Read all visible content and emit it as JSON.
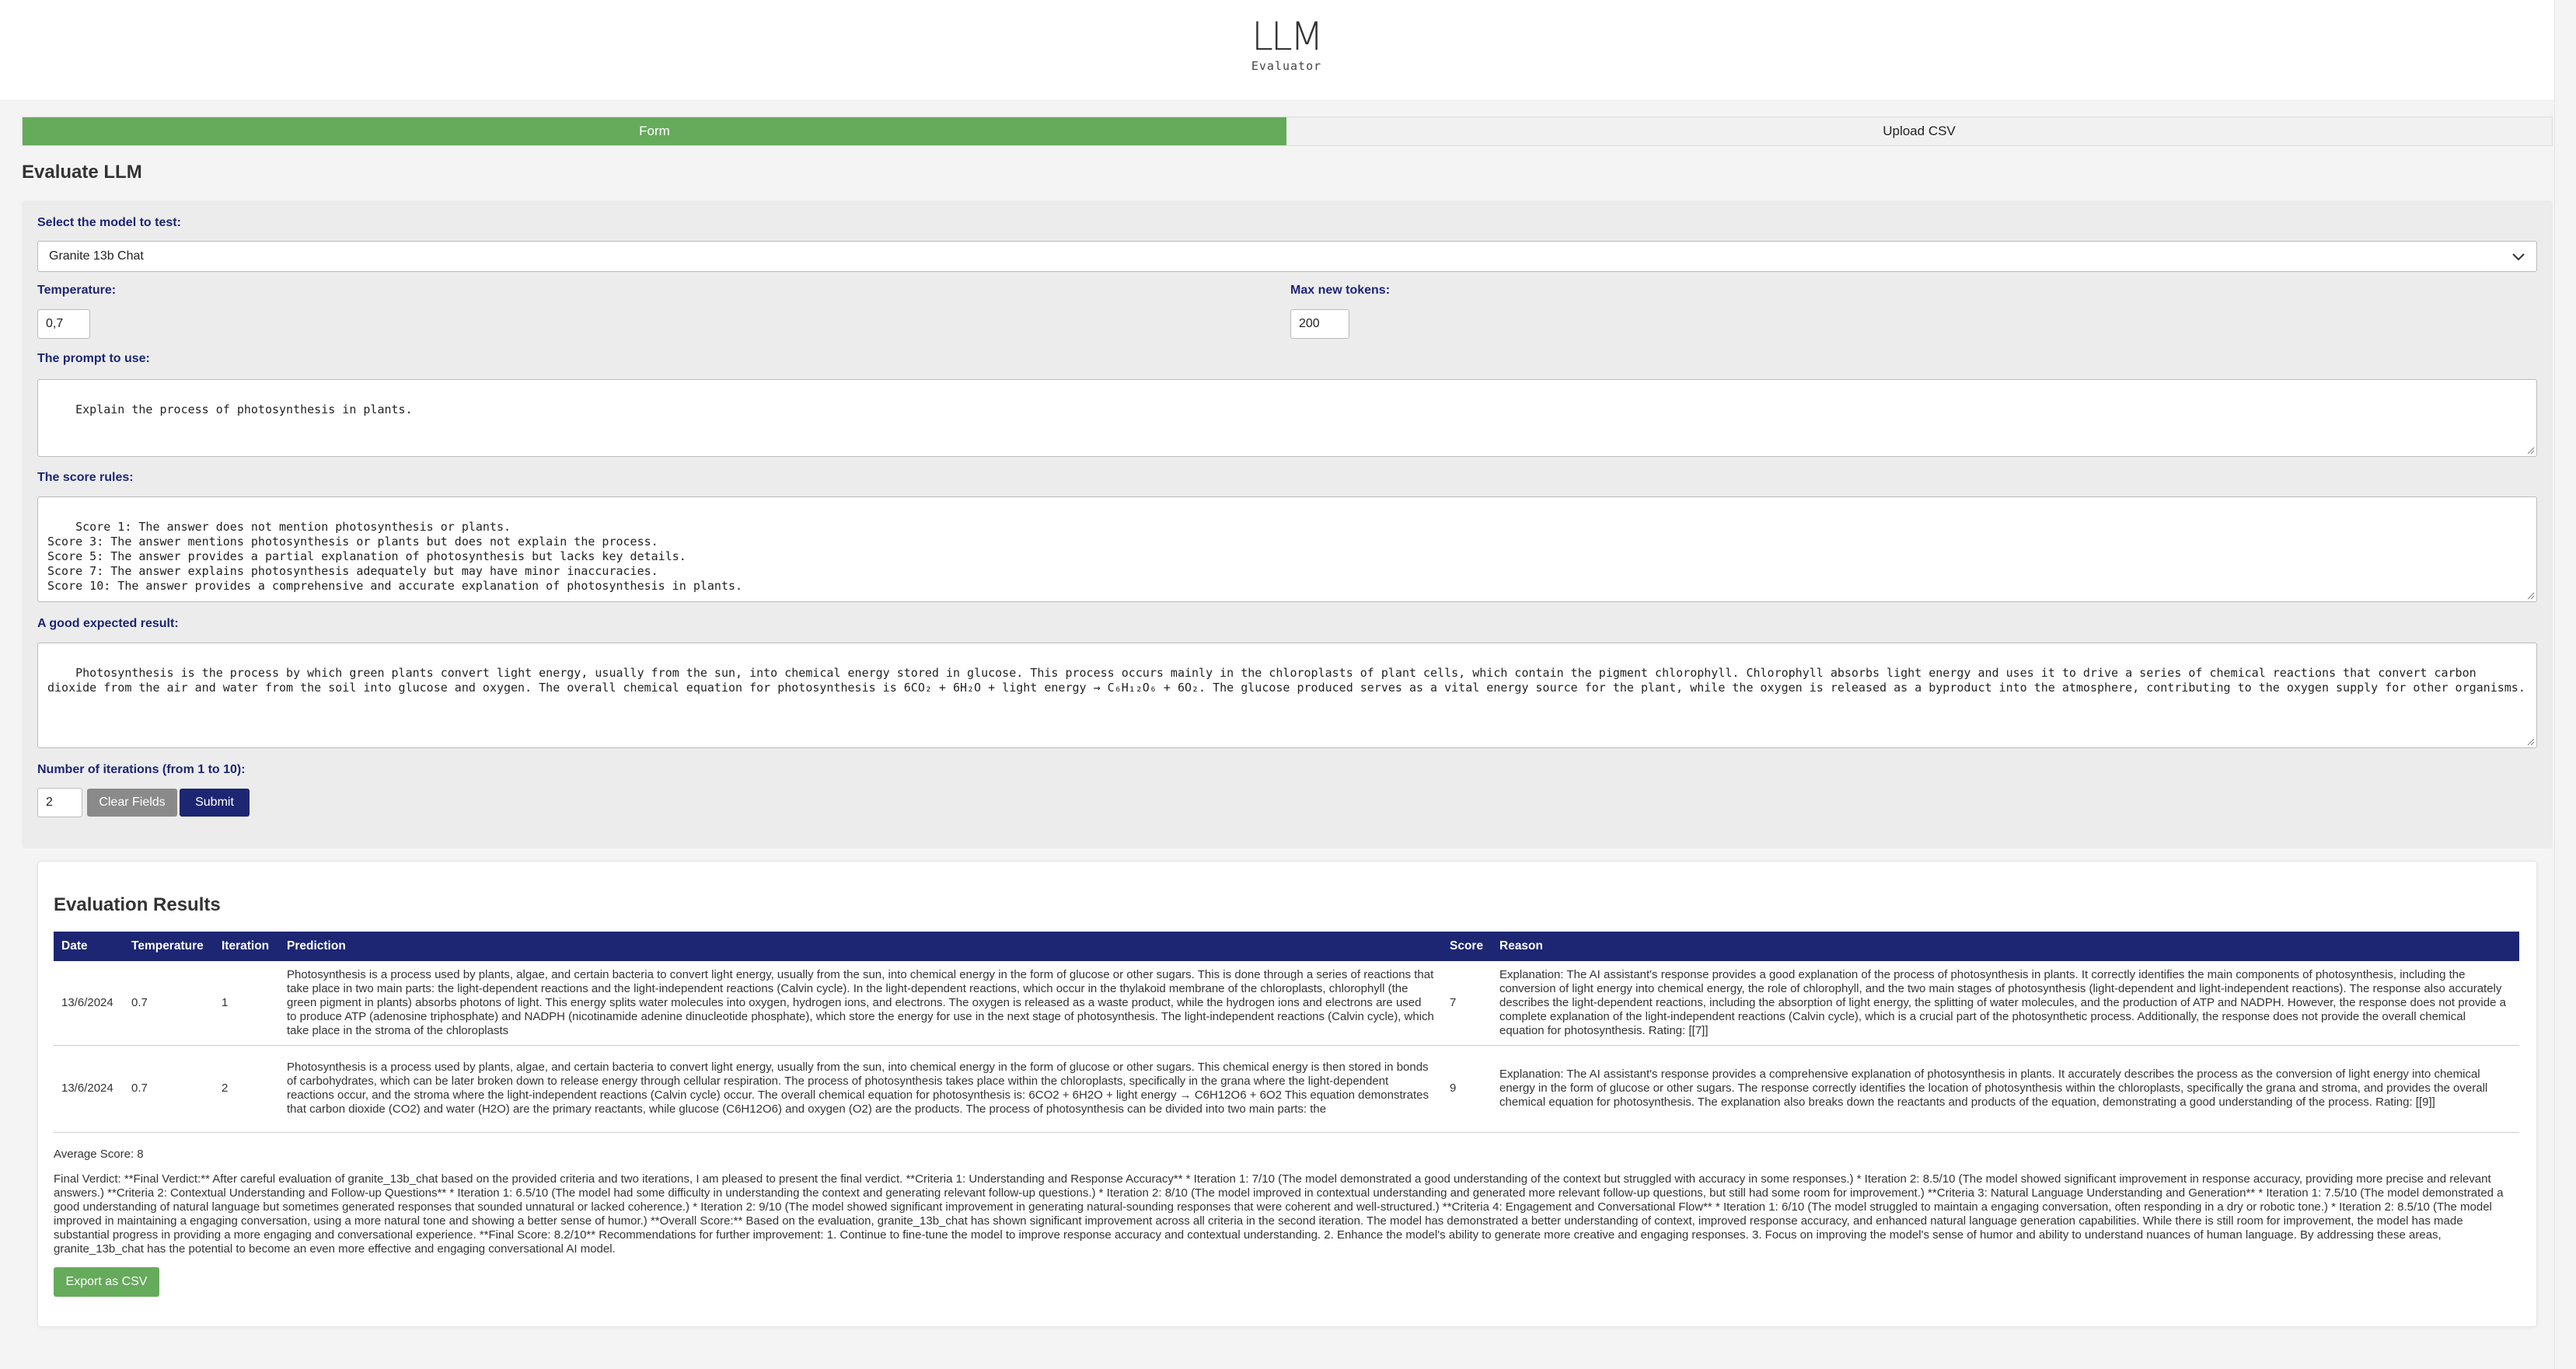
{
  "logo": {
    "mark": "LLM",
    "subtitle": "Evaluator"
  },
  "tabs": [
    {
      "label": "Form",
      "active": true
    },
    {
      "label": "Upload CSV",
      "active": false
    }
  ],
  "page_title": "Evaluate LLM",
  "form": {
    "model_label": "Select the model to test:",
    "model_value": "Granite 13b Chat",
    "temperature_label": "Temperature:",
    "temperature_value": "0,7",
    "max_tokens_label": "Max new tokens:",
    "max_tokens_value": "200",
    "prompt_label": "The prompt to use:",
    "prompt_value": "Explain the process of photosynthesis in plants.",
    "score_rules_label": "The score rules:",
    "score_rules_value": "Score 1: The answer does not mention photosynthesis or plants.\nScore 3: The answer mentions photosynthesis or plants but does not explain the process.\nScore 5: The answer provides a partial explanation of photosynthesis but lacks key details.\nScore 7: The answer explains photosynthesis adequately but may have minor inaccuracies.\nScore 10: The answer provides a comprehensive and accurate explanation of photosynthesis in plants.",
    "expected_label": "A good expected result:",
    "expected_value": "Photosynthesis is the process by which green plants convert light energy, usually from the sun, into chemical energy stored in glucose. This process occurs mainly in the chloroplasts of plant cells, which contain the pigment chlorophyll. Chlorophyll absorbs light energy and uses it to drive a series of chemical reactions that convert carbon dioxide from the air and water from the soil into glucose and oxygen. The overall chemical equation for photosynthesis is 6CO₂ + 6H₂O + light energy → C₆H₁₂O₆ + 6O₂. The glucose produced serves as a vital energy source for the plant, while the oxygen is released as a byproduct into the atmosphere, contributing to the oxygen supply for other organisms.",
    "iterations_label": "Number of iterations (from 1 to 10):",
    "iterations_value": "2",
    "clear_label": "Clear Fields",
    "submit_label": "Submit"
  },
  "results": {
    "title": "Evaluation Results",
    "columns": [
      "Date",
      "Temperature",
      "Iteration",
      "Prediction",
      "Score",
      "Reason"
    ],
    "rows": [
      {
        "date": "13/6/2024",
        "temperature": "0.7",
        "iteration": "1",
        "prediction": "Photosynthesis is a process used by plants, algae, and certain bacteria to convert light energy, usually from the sun, into chemical energy in the form of glucose or other sugars. This is done through a series of reactions that take place in two main parts: the light-dependent reactions and the light-independent reactions (Calvin cycle). In the light-dependent reactions, which occur in the thylakoid membrane of the chloroplasts, chlorophyll (the green pigment in plants) absorbs photons of light. This energy splits water molecules into oxygen, hydrogen ions, and electrons. The oxygen is released as a waste product, while the hydrogen ions and electrons are used to produce ATP (adenosine triphosphate) and NADPH (nicotinamide adenine dinucleotide phosphate), which store the energy for use in the next stage of photosynthesis. The light-independent reactions (Calvin cycle), which take place in the stroma of the chloroplasts",
        "score": "7",
        "reason": "Explanation: The AI assistant's response provides a good explanation of the process of photosynthesis in plants. It correctly identifies the main components of photosynthesis, including the conversion of light energy into chemical energy, the role of chlorophyll, and the two main stages of photosynthesis (light-dependent and light-independent reactions). The response also accurately describes the light-dependent reactions, including the absorption of light energy, the splitting of water molecules, and the production of ATP and NADPH. However, the response does not provide a complete explanation of the light-independent reactions (Calvin cycle), which is a crucial part of the photosynthetic process. Additionally, the response does not provide the overall chemical equation for photosynthesis. Rating: [[7]]"
      },
      {
        "date": "13/6/2024",
        "temperature": "0.7",
        "iteration": "2",
        "prediction": "Photosynthesis is a process used by plants, algae, and certain bacteria to convert light energy, usually from the sun, into chemical energy in the form of glucose or other sugars. This chemical energy is then stored in bonds of carbohydrates, which can be later broken down to release energy through cellular respiration. The process of photosynthesis takes place within the chloroplasts, specifically in the grana where the light-dependent reactions occur, and the stroma where the light-independent reactions (Calvin cycle) occur. The overall chemical equation for photosynthesis is: 6CO2 + 6H2O + light energy → C6H12O6 + 6O2 This equation demonstrates that carbon dioxide (CO2) and water (H2O) are the primary reactants, while glucose (C6H12O6) and oxygen (O2) are the products. The process of photosynthesis can be divided into two main parts: the",
        "score": "9",
        "reason": "Explanation: The AI assistant's response provides a comprehensive explanation of photosynthesis in plants. It accurately describes the process as the conversion of light energy into chemical energy in the form of glucose or other sugars. The response correctly identifies the location of photosynthesis within the chloroplasts, specifically the grana and stroma, and provides the overall chemical equation for photosynthesis. The explanation also breaks down the reactants and products of the equation, demonstrating a good understanding of the process. Rating: [[9]]"
      }
    ],
    "average": "Average Score: 8",
    "verdict": "Final Verdict: **Final Verdict:** After careful evaluation of granite_13b_chat based on the provided criteria and two iterations, I am pleased to present the final verdict. **Criteria 1: Understanding and Response Accuracy** * Iteration 1: 7/10 (The model demonstrated a good understanding of the context but struggled with accuracy in some responses.) * Iteration 2: 8.5/10 (The model showed significant improvement in response accuracy, providing more precise and relevant answers.) **Criteria 2: Contextual Understanding and Follow-up Questions** * Iteration 1: 6.5/10 (The model had some difficulty in understanding the context and generating relevant follow-up questions.) * Iteration 2: 8/10 (The model improved in contextual understanding and generated more relevant follow-up questions, but still had some room for improvement.) **Criteria 3: Natural Language Understanding and Generation** * Iteration 1: 7.5/10 (The model demonstrated a good understanding of natural language but sometimes generated responses that sounded unnatural or lacked coherence.) * Iteration 2: 9/10 (The model showed significant improvement in generating natural-sounding responses that were coherent and well-structured.) **Criteria 4: Engagement and Conversational Flow** * Iteration 1: 6/10 (The model struggled to maintain a engaging conversation, often responding in a dry or robotic tone.) * Iteration 2: 8.5/10 (The model improved in maintaining a engaging conversation, using a more natural tone and showing a better sense of humor.) **Overall Score:** Based on the evaluation, granite_13b_chat has shown significant improvement across all criteria in the second iteration. The model has demonstrated a better understanding of context, improved response accuracy, and enhanced natural language generation capabilities. While there is still room for improvement, the model has made substantial progress in providing a more engaging and conversational experience. **Final Score: 8.2/10** Recommendations for further improvement: 1. Continue to fine-tune the model to improve response accuracy and contextual understanding. 2. Enhance the model's ability to generate more creative and engaging responses. 3. Focus on improving the model's sense of humor and ability to understand nuances of human language. By addressing these areas, granite_13b_chat has the potential to become an even more effective and engaging conversational AI model.",
    "export_label": "Export as CSV"
  },
  "colors": {
    "accent_green": "#66aa5b",
    "navy": "#1d2673",
    "clear_grey": "#8a8a8a"
  }
}
